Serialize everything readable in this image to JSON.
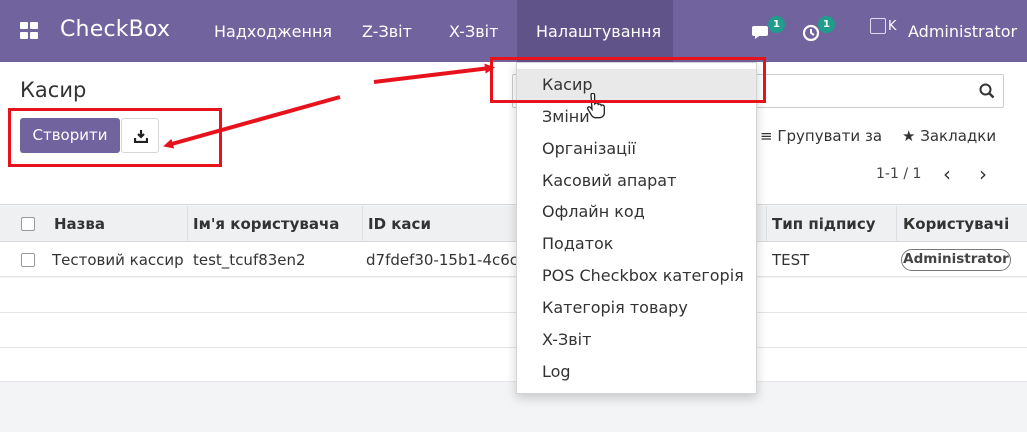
{
  "navbar": {
    "brand": "CheckBox",
    "menu": [
      "Надходження",
      "Z-Звіт",
      "X-Звіт",
      "Налаштування"
    ],
    "messages_count": "1",
    "activities_count": "1",
    "avatar_alt": "K",
    "user_name": "Administrator"
  },
  "control_panel": {
    "title": "Касир",
    "create_label": "Створити",
    "group_by_label": "Групувати за",
    "favorites_label": "Закладки",
    "pager_value": "1-1 / 1"
  },
  "table": {
    "columns": [
      "Назва",
      "Ім'я користувача",
      "ID каси",
      "Тип підпису",
      "Користувачі"
    ],
    "rows": [
      {
        "name": "Тестовий кассир",
        "username": "test_tcuf83en2",
        "cash_id": "d7fdef30-15b1-4c6c-",
        "signature_type": "TEST",
        "users_tag": "Administrator"
      }
    ]
  },
  "dropdown": {
    "items": [
      "Касир",
      "Зміни",
      "Організації",
      "Касовий апарат",
      "Офлайн код",
      "Податок",
      "POS Checkbox категорія",
      "Категорія товару",
      "X-Звіт",
      "Log"
    ]
  },
  "colors": {
    "navbar": "#71639e",
    "primary_button": "#71639e",
    "badge": "#1f9c8b",
    "annotation": "#e8121c"
  },
  "icons": [
    "apps-grid-icon",
    "chat-icon",
    "clock-icon",
    "download-icon",
    "search-icon",
    "list-icon",
    "star-icon",
    "chevron-left-icon",
    "chevron-right-icon",
    "hand-cursor-icon"
  ]
}
